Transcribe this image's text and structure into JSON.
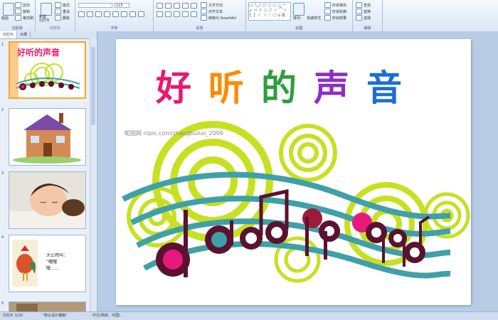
{
  "ribbon": {
    "groups": {
      "clipboard": {
        "label": "剪贴板",
        "paste": "粘贴",
        "cut": "剪切",
        "copy": "复制",
        "format": "格式刷"
      },
      "slides": {
        "label": "幻灯片",
        "new_slide": "新建\n幻灯片",
        "layout": "版式",
        "reset": "重设",
        "delete": "删除"
      },
      "font": {
        "label": "字体",
        "font_size": "115"
      },
      "paragraph": {
        "label": "段落",
        "text_direction": "文字方向",
        "align_text": "对齐文本",
        "smartart": "转换为 SmartArt"
      },
      "drawing": {
        "label": "绘图",
        "arrange": "排列",
        "quick_styles": "快速样式",
        "shape_fill": "形状填充",
        "shape_outline": "形状轮廓",
        "shape_effects": "形状效果"
      },
      "editing": {
        "label": "编辑",
        "find": "查找",
        "replace": "替换",
        "select": "选择"
      }
    }
  },
  "left_pane": {
    "tabs": [
      "幻灯片",
      "大纲"
    ],
    "slide_numbers": [
      "1",
      "2",
      "3",
      "4",
      "5"
    ],
    "slide1_title": "好听的声音",
    "slide4_text_line1": "大公鸡叫：",
    "slide4_text_line2": "“喔喔",
    "slide4_text_line3": "喔……"
  },
  "slide": {
    "title": "好听的声音",
    "watermark": "昵图网 nipic.com/zhangbuluo_2009"
  },
  "status": {
    "slide_info": "幻灯片 1/10",
    "theme": "\"默认设计模板\"",
    "language": "中文(简体，中国)"
  },
  "colors": {
    "title_chars": [
      "#e8196e",
      "#ff8a00",
      "#2f9e3c",
      "#8c2fc2",
      "#1c6fd1"
    ],
    "lime": "#c7e022",
    "teal": "#3fa0a8",
    "note_dark": "#5a1230",
    "note_pink": "#e8197d"
  }
}
